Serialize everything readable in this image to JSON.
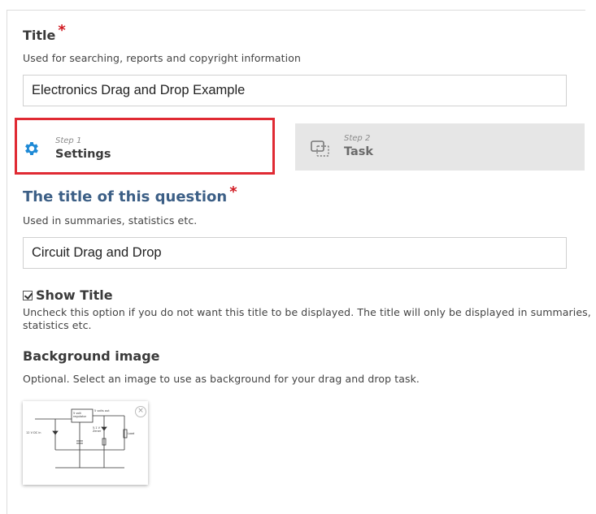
{
  "title_field": {
    "label": "Title",
    "required_mark": "*",
    "description": "Used for searching, reports and copyright information",
    "value": "Electronics Drag and Drop Example"
  },
  "steps": [
    {
      "small": "Step 1",
      "name": "Settings",
      "icon": "gear-icon",
      "active": true
    },
    {
      "small": "Step 2",
      "name": "Task",
      "icon": "drag-drop-icon",
      "active": false
    }
  ],
  "question_title": {
    "label": "The title of this question",
    "required_mark": "*",
    "description": "Used in summaries, statistics etc.",
    "value": "Circuit Drag and Drop"
  },
  "show_title": {
    "label": "Show Title",
    "checked": true,
    "description_line1": "Uncheck this option if you do not want this title to be displayed. The title will only be displayed in summaries,",
    "description_line2": "statistics etc."
  },
  "background_image": {
    "label": "Background image",
    "description": "Optional. Select an image to use as background for your drag and drop task.",
    "thumb_labels": {
      "regulator": "5 volt regulator",
      "out": "5 volts out",
      "dc_in": "12 V DC in",
      "zener": "5.1 V Zener",
      "load": "Load"
    }
  },
  "colors": {
    "accent_blue": "#3c5f86",
    "gear_blue": "#1f8ad6",
    "required_red": "#d0171f",
    "highlight_red": "#e02a33"
  }
}
